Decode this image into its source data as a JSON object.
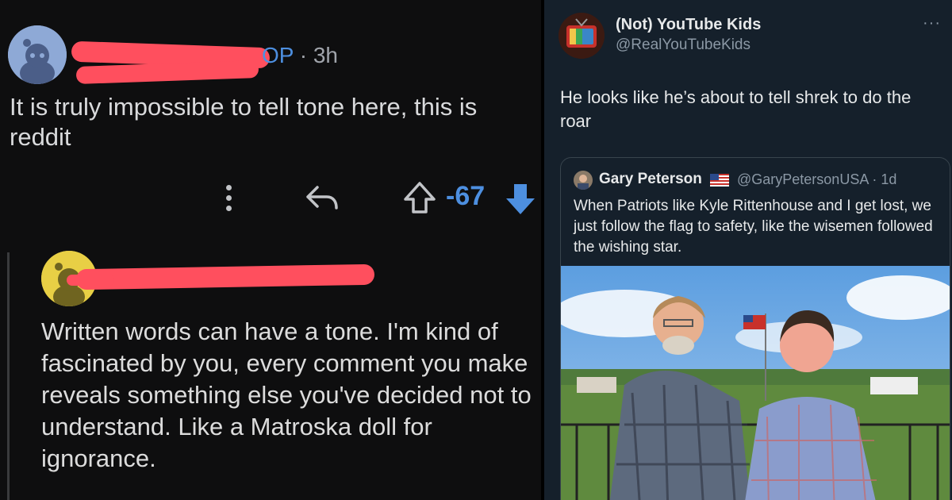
{
  "reddit": {
    "op_comment": {
      "op_tag": "OP",
      "time": "3h",
      "text": "It is truly impossible to tell tone here, this is reddit",
      "score": "-67"
    },
    "reply_comment": {
      "text": "Written words can have a tone. I'm kind of fascinated by you, every comment you make reveals something else you've decided not to understand. Like a Matroska doll for ignorance."
    },
    "colors": {
      "background": "#0e0e0f",
      "accent": "#4d8fe0",
      "redaction": "#ff4f5e"
    }
  },
  "tweet": {
    "display_name": "(Not) YouTube Kids",
    "handle": "@RealYouTubeKids",
    "more": "···",
    "text": "He looks like he’s about to tell shrek to do the roar",
    "quote": {
      "display_name": "Gary Peterson",
      "handle_time": "@GaryPetersonUSA · 1d",
      "text": "When Patriots like Kyle Rittenhouse and I get lost, we just follow the flag to safety, like the wisemen followed the wishing star."
    },
    "colors": {
      "background": "#15202b",
      "text": "#e7e9ea",
      "muted": "#8b98a5",
      "border": "#38444d"
    }
  }
}
